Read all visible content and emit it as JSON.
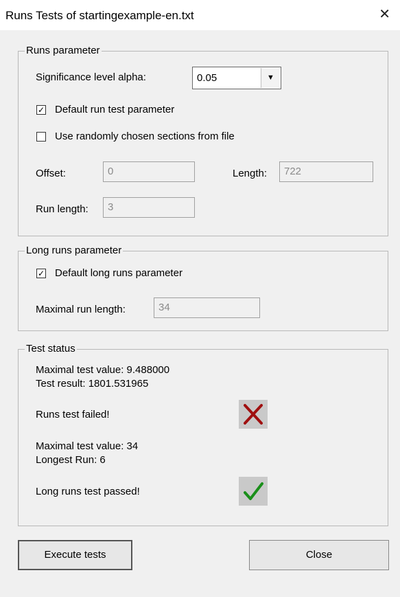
{
  "window": {
    "title": "Runs Tests of startingexample-en.txt",
    "close_glyph": "✕"
  },
  "runs_parameter": {
    "legend": "Runs parameter",
    "alpha_label": "Significance level alpha:",
    "alpha_value": "0.05",
    "default_checkbox_label": "Default run test parameter",
    "default_checked": true,
    "random_checkbox_label": "Use randomly chosen sections from file",
    "random_checked": false,
    "offset_label": "Offset:",
    "offset_value": "0",
    "length_label": "Length:",
    "length_value": "722",
    "run_length_label": "Run length:",
    "run_length_value": "3"
  },
  "long_runs_parameter": {
    "legend": "Long runs parameter",
    "default_checkbox_label": "Default long runs parameter",
    "default_checked": true,
    "max_run_length_label": "Maximal run length:",
    "max_run_length_value": "34"
  },
  "test_status": {
    "legend": "Test status",
    "runs_max_value_line": "Maximal test value: 9.488000",
    "runs_result_line": "Test result: 1801.531965",
    "runs_message": "Runs test failed!",
    "runs_icon": "cross-icon",
    "runs_icon_color": "#a01010",
    "long_max_value_line": "Maximal test value: 34",
    "longest_run_line": "Longest Run: 6",
    "long_message": "Long runs test passed!",
    "long_icon": "checkmark-icon",
    "long_icon_color": "#1a8f1a"
  },
  "buttons": {
    "execute": "Execute tests",
    "close": "Close"
  }
}
